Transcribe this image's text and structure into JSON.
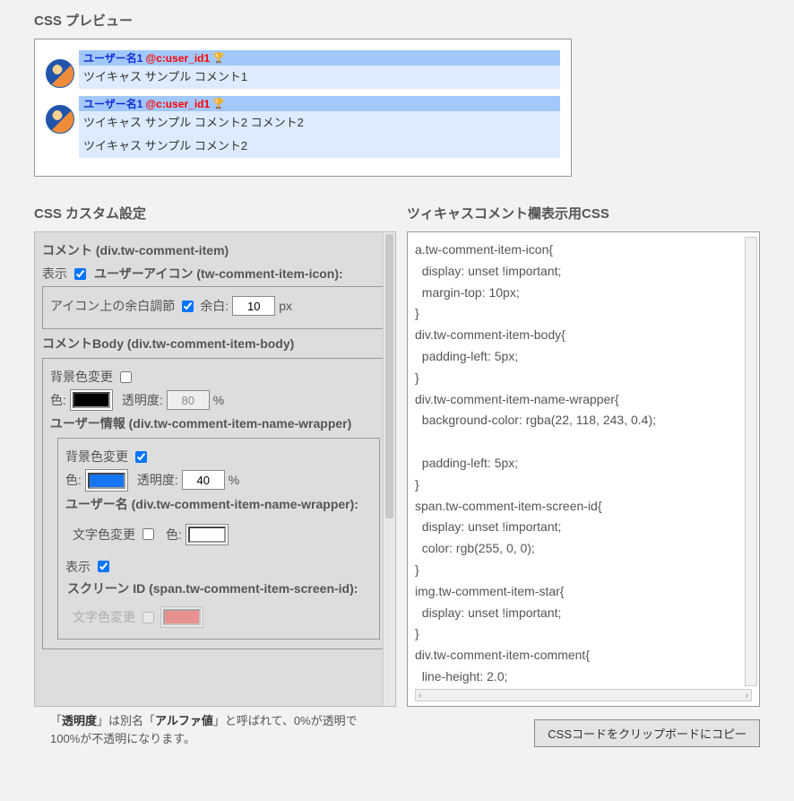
{
  "preview": {
    "heading": "CSS プレビュー",
    "items": [
      {
        "username": "ユーザー名1",
        "screen_id": "@c:user_id1",
        "comments": [
          "ツイキャス サンプル コメント1"
        ]
      },
      {
        "username": "ユーザー名1",
        "screen_id": "@c:user_id1",
        "comments": [
          "ツイキャス サンプル コメント2 コメント2",
          "ツイキャス サンプル コメント2"
        ]
      }
    ]
  },
  "custom": {
    "heading": "CSS カスタム設定",
    "root_legend": "コメント (div.tw-comment-item)",
    "icon": {
      "show_label": "表示",
      "legend": "ユーザーアイコン (tw-comment-item-icon):",
      "margin_label": "アイコン上の余白調節",
      "margin_prefix": "余白:",
      "margin_val": "10",
      "margin_unit": "px"
    },
    "body": {
      "legend": "コメントBody (div.tw-comment-item-body)",
      "bg_label": "背景色変更",
      "color_label": "色:",
      "color_val": "#000000",
      "opacity_label": "透明度:",
      "opacity_val": "80",
      "opacity_unit": "%"
    },
    "namewrap": {
      "legend": "ユーザー情報 (div.tw-comment-item-name-wrapper)",
      "bg_label": "背景色変更",
      "color_label": "色:",
      "color_val": "#1676f3",
      "opacity_label": "透明度:",
      "opacity_val": "40",
      "opacity_unit": "%",
      "username_legend": "ユーザー名 (div.tw-comment-item-name-wrapper):",
      "textcolor_label": "文字色変更",
      "textcolor_prefix": "色:",
      "screenid_show_label": "表示",
      "screenid_legend": "スクリーン ID (span.tw-comment-item-screen-id):",
      "screenid_textcolor_label": "文字色変更"
    },
    "footnote_html": "「<b>透明度</b>」は別名「<b>アルファ値</b>」と呼ばれて、0%が透明で100%が不透明になります。"
  },
  "output": {
    "heading": "ツィキャスコメント欄表示用CSS",
    "css": "a.tw-comment-item-icon{\n  display: unset !important;\n  margin-top: 10px;\n}\ndiv.tw-comment-item-body{\n  padding-left: 5px;\n}\ndiv.tw-comment-item-name-wrapper{\n  background-color: rgba(22, 118, 243, 0.4);\n\n  padding-left: 5px;\n}\nspan.tw-comment-item-screen-id{\n  display: unset !important;\n  color: rgb(255, 0, 0);\n}\nimg.tw-comment-item-star{\n  display: unset !important;\n}\ndiv.tw-comment-item-comment{\n  line-height: 2.0;",
    "copy_label": "CSSコードをクリップボードにコピー"
  }
}
